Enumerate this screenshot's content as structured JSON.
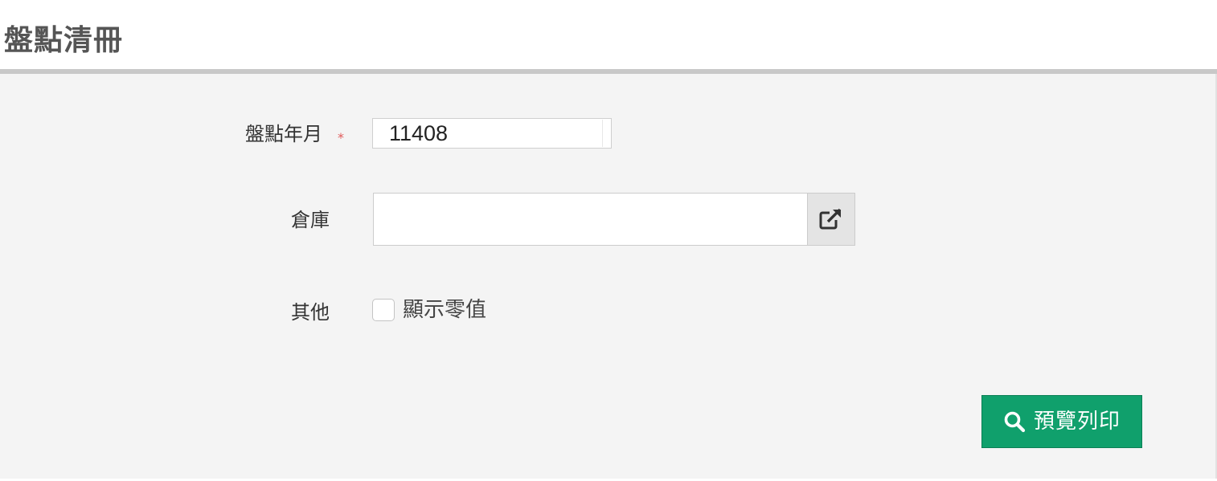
{
  "page": {
    "title": "盤點清冊"
  },
  "form": {
    "period": {
      "label": "盤點年月",
      "required_mark": "*",
      "value": "11408"
    },
    "warehouse": {
      "label": "倉庫",
      "value": "",
      "picker_icon": "external-link-icon"
    },
    "other": {
      "label": "其他",
      "show_zero_label": "顯示零值",
      "show_zero_checked": false
    }
  },
  "actions": {
    "preview_print_label": "預覽列印",
    "preview_print_icon": "search-icon",
    "primary_color": "#10a06c"
  }
}
